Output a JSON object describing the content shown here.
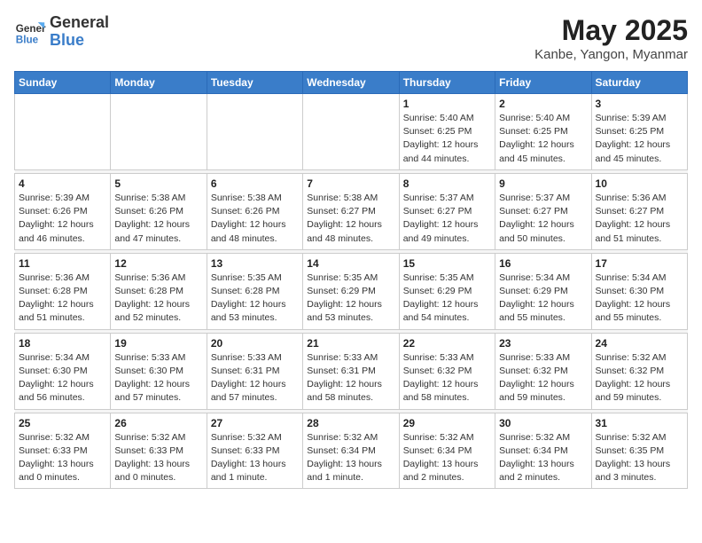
{
  "logo": {
    "line1": "General",
    "line2": "Blue"
  },
  "title": "May 2025",
  "subtitle": "Kanbe, Yangon, Myanmar",
  "days": [
    "Sunday",
    "Monday",
    "Tuesday",
    "Wednesday",
    "Thursday",
    "Friday",
    "Saturday"
  ],
  "weeks": [
    [
      {
        "date": "",
        "info": ""
      },
      {
        "date": "",
        "info": ""
      },
      {
        "date": "",
        "info": ""
      },
      {
        "date": "",
        "info": ""
      },
      {
        "date": "1",
        "info": "Sunrise: 5:40 AM\nSunset: 6:25 PM\nDaylight: 12 hours\nand 44 minutes."
      },
      {
        "date": "2",
        "info": "Sunrise: 5:40 AM\nSunset: 6:25 PM\nDaylight: 12 hours\nand 45 minutes."
      },
      {
        "date": "3",
        "info": "Sunrise: 5:39 AM\nSunset: 6:25 PM\nDaylight: 12 hours\nand 45 minutes."
      }
    ],
    [
      {
        "date": "4",
        "info": "Sunrise: 5:39 AM\nSunset: 6:26 PM\nDaylight: 12 hours\nand 46 minutes."
      },
      {
        "date": "5",
        "info": "Sunrise: 5:38 AM\nSunset: 6:26 PM\nDaylight: 12 hours\nand 47 minutes."
      },
      {
        "date": "6",
        "info": "Sunrise: 5:38 AM\nSunset: 6:26 PM\nDaylight: 12 hours\nand 48 minutes."
      },
      {
        "date": "7",
        "info": "Sunrise: 5:38 AM\nSunset: 6:27 PM\nDaylight: 12 hours\nand 48 minutes."
      },
      {
        "date": "8",
        "info": "Sunrise: 5:37 AM\nSunset: 6:27 PM\nDaylight: 12 hours\nand 49 minutes."
      },
      {
        "date": "9",
        "info": "Sunrise: 5:37 AM\nSunset: 6:27 PM\nDaylight: 12 hours\nand 50 minutes."
      },
      {
        "date": "10",
        "info": "Sunrise: 5:36 AM\nSunset: 6:27 PM\nDaylight: 12 hours\nand 51 minutes."
      }
    ],
    [
      {
        "date": "11",
        "info": "Sunrise: 5:36 AM\nSunset: 6:28 PM\nDaylight: 12 hours\nand 51 minutes."
      },
      {
        "date": "12",
        "info": "Sunrise: 5:36 AM\nSunset: 6:28 PM\nDaylight: 12 hours\nand 52 minutes."
      },
      {
        "date": "13",
        "info": "Sunrise: 5:35 AM\nSunset: 6:28 PM\nDaylight: 12 hours\nand 53 minutes."
      },
      {
        "date": "14",
        "info": "Sunrise: 5:35 AM\nSunset: 6:29 PM\nDaylight: 12 hours\nand 53 minutes."
      },
      {
        "date": "15",
        "info": "Sunrise: 5:35 AM\nSunset: 6:29 PM\nDaylight: 12 hours\nand 54 minutes."
      },
      {
        "date": "16",
        "info": "Sunrise: 5:34 AM\nSunset: 6:29 PM\nDaylight: 12 hours\nand 55 minutes."
      },
      {
        "date": "17",
        "info": "Sunrise: 5:34 AM\nSunset: 6:30 PM\nDaylight: 12 hours\nand 55 minutes."
      }
    ],
    [
      {
        "date": "18",
        "info": "Sunrise: 5:34 AM\nSunset: 6:30 PM\nDaylight: 12 hours\nand 56 minutes."
      },
      {
        "date": "19",
        "info": "Sunrise: 5:33 AM\nSunset: 6:30 PM\nDaylight: 12 hours\nand 57 minutes."
      },
      {
        "date": "20",
        "info": "Sunrise: 5:33 AM\nSunset: 6:31 PM\nDaylight: 12 hours\nand 57 minutes."
      },
      {
        "date": "21",
        "info": "Sunrise: 5:33 AM\nSunset: 6:31 PM\nDaylight: 12 hours\nand 58 minutes."
      },
      {
        "date": "22",
        "info": "Sunrise: 5:33 AM\nSunset: 6:32 PM\nDaylight: 12 hours\nand 58 minutes."
      },
      {
        "date": "23",
        "info": "Sunrise: 5:33 AM\nSunset: 6:32 PM\nDaylight: 12 hours\nand 59 minutes."
      },
      {
        "date": "24",
        "info": "Sunrise: 5:32 AM\nSunset: 6:32 PM\nDaylight: 12 hours\nand 59 minutes."
      }
    ],
    [
      {
        "date": "25",
        "info": "Sunrise: 5:32 AM\nSunset: 6:33 PM\nDaylight: 13 hours\nand 0 minutes."
      },
      {
        "date": "26",
        "info": "Sunrise: 5:32 AM\nSunset: 6:33 PM\nDaylight: 13 hours\nand 0 minutes."
      },
      {
        "date": "27",
        "info": "Sunrise: 5:32 AM\nSunset: 6:33 PM\nDaylight: 13 hours\nand 1 minute."
      },
      {
        "date": "28",
        "info": "Sunrise: 5:32 AM\nSunset: 6:34 PM\nDaylight: 13 hours\nand 1 minute."
      },
      {
        "date": "29",
        "info": "Sunrise: 5:32 AM\nSunset: 6:34 PM\nDaylight: 13 hours\nand 2 minutes."
      },
      {
        "date": "30",
        "info": "Sunrise: 5:32 AM\nSunset: 6:34 PM\nDaylight: 13 hours\nand 2 minutes."
      },
      {
        "date": "31",
        "info": "Sunrise: 5:32 AM\nSunset: 6:35 PM\nDaylight: 13 hours\nand 3 minutes."
      }
    ]
  ]
}
